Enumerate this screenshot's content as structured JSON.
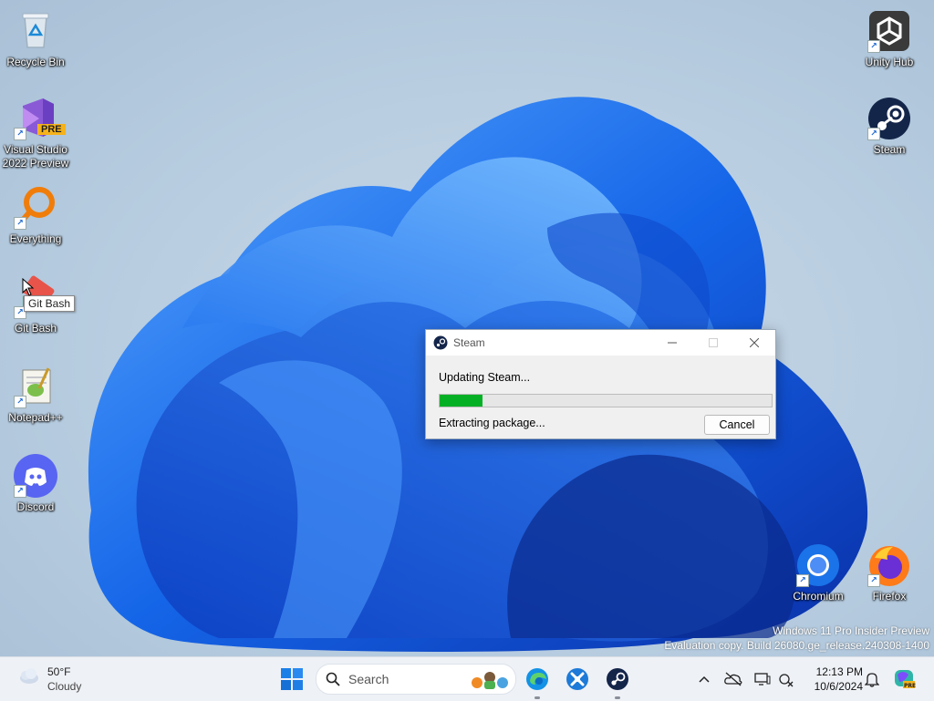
{
  "desktop": {
    "icons_left": [
      {
        "label": "Recycle Bin",
        "icon": "recycle-bin-icon"
      },
      {
        "label": "Visual Studio\n2022 Preview",
        "icon": "visual-studio-preview-icon",
        "badge": "PRE"
      },
      {
        "label": "Everything",
        "icon": "everything-search-icon"
      },
      {
        "label": "Git Bash",
        "icon": "git-bash-icon"
      },
      {
        "label": "Notepad++",
        "icon": "notepad-plus-plus-icon"
      },
      {
        "label": "Discord",
        "icon": "discord-icon"
      }
    ],
    "icons_right": [
      {
        "label": "Unity Hub",
        "icon": "unity-hub-icon"
      },
      {
        "label": "Steam",
        "icon": "steam-icon"
      },
      {
        "label": "Chromium",
        "icon": "chromium-icon"
      },
      {
        "label": "Firefox",
        "icon": "firefox-icon"
      }
    ],
    "tooltip": "Git Bash",
    "watermark": {
      "line1": "Windows 11 Pro Insider Preview",
      "line2": "Evaluation copy. Build 26080.ge_release.240308-1400"
    }
  },
  "dialog": {
    "title": "Steam",
    "status": "Updating Steam...",
    "progress_fraction": 0.13,
    "detail": "Extracting package...",
    "cancel_label": "Cancel",
    "colors": {
      "progress": "#06b025"
    }
  },
  "taskbar": {
    "weather": {
      "temp": "50°F",
      "desc": "Cloudy"
    },
    "search_placeholder": "Search",
    "pinned": [
      "windows-start-icon",
      "edge-icon",
      "app-icon",
      "steam-icon"
    ],
    "tray": [
      "chevron-up-icon",
      "onedrive-offline-icon",
      "display-icon",
      "network-icon"
    ],
    "clock": {
      "time": "12:13 PM",
      "date": "10/6/2024"
    }
  }
}
